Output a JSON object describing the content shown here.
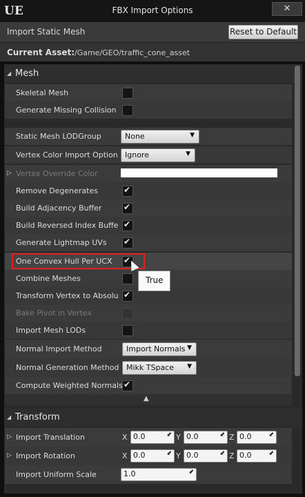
{
  "window": {
    "title": "FBX Import Options",
    "logo": "UE",
    "close_glyph": "✕"
  },
  "header": {
    "import_label": "Import Static Mesh",
    "reset_label": "Reset to Default"
  },
  "asset": {
    "label": "Current Asset:",
    "value": "/Game/GEO/traffic_cone_asset"
  },
  "mesh": {
    "title": "Mesh",
    "rows": [
      {
        "label": "Skeletal Mesh",
        "checked": false
      },
      {
        "label": "Generate Missing Collision",
        "checked": false
      },
      {
        "label": "Static Mesh LODGroup",
        "dropdown": "None"
      },
      {
        "label": "Vertex Color Import Option",
        "dropdown": "Ignore"
      },
      {
        "label": "Vertex Override Color",
        "disabled": true
      },
      {
        "label": "Remove Degenerates",
        "checked": true
      },
      {
        "label": "Build Adjacency Buffer",
        "checked": true
      },
      {
        "label": "Build Reversed Index Buffer",
        "checked": true
      },
      {
        "label": "Generate Lightmap UVs",
        "checked": true
      },
      {
        "label": "One Convex Hull Per UCX",
        "checked": true
      },
      {
        "label": "Combine Meshes",
        "checked": false
      },
      {
        "label": "Transform Vertex to Absolute",
        "checked": true
      },
      {
        "label": "Bake Pivot in Vertex",
        "checked": false,
        "disabled": true
      },
      {
        "label": "Import Mesh LODs",
        "checked": false
      },
      {
        "label": "Normal Import Method",
        "dropdown": "Import Normals"
      },
      {
        "label": "Normal Generation Method",
        "dropdown": "Mikk TSpace"
      },
      {
        "label": "Compute Weighted Normals",
        "checked": true
      }
    ]
  },
  "tooltip": "True",
  "transform": {
    "title": "Transform",
    "translation": {
      "label": "Import Translation",
      "x": "0.0",
      "y": "0.0",
      "z": "0.0"
    },
    "rotation": {
      "label": "Import Rotation",
      "x": "0.0",
      "y": "0.0",
      "z": "0.0"
    },
    "scale": {
      "label": "Import Uniform Scale",
      "value": "1.0"
    },
    "axis_x": "X",
    "axis_y": "Y",
    "axis_z": "Z"
  },
  "colors": {
    "highlight": "#e02020",
    "panel": "#2a2a2a",
    "row": "#3b3b3b"
  }
}
